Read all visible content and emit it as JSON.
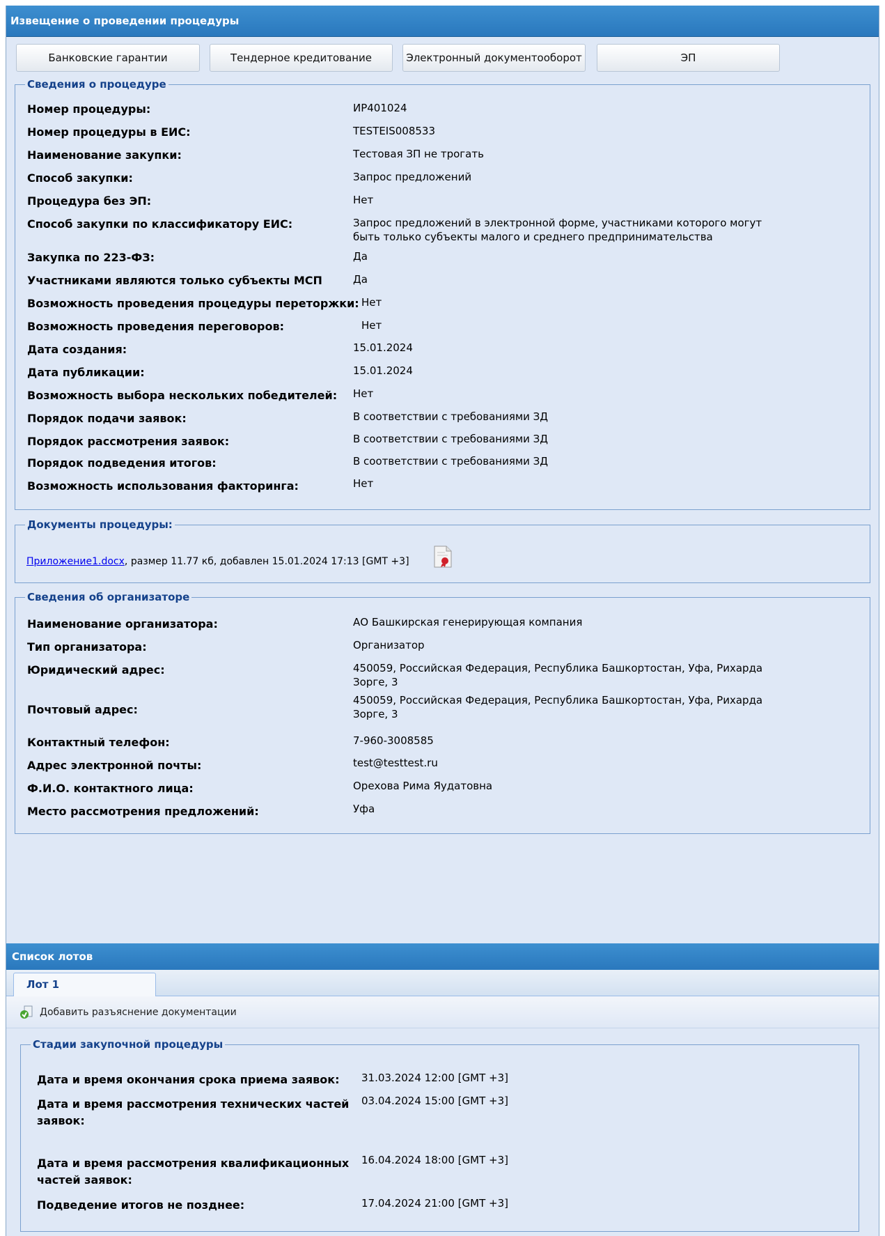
{
  "window": {
    "title": "Извещение о проведении процедуры"
  },
  "top_buttons": [
    {
      "label": "Банковские гарантии"
    },
    {
      "label": "Тендерное кредитование"
    },
    {
      "label": "Электронный документооборот"
    },
    {
      "label": "ЭП"
    }
  ],
  "procedure": {
    "legend": "Сведения о процедуре",
    "rows": [
      {
        "label": "Номер процедуры:",
        "value": "ИР401024"
      },
      {
        "label": "Номер процедуры в ЕИС:",
        "value": "TESTEIS008533"
      },
      {
        "label": "Наименование закупки:",
        "value": "Тестовая ЗП не трогать"
      },
      {
        "label": "Способ закупки:",
        "value": "Запрос предложений"
      },
      {
        "label": "Процедура без ЭП:",
        "value": "Нет"
      },
      {
        "label": "Способ закупки по классификатору ЕИС:",
        "value": "Запрос предложений в электронной форме, участниками которого могут быть только субъекты малого и среднего предпринимательства"
      },
      {
        "label": "Закупка по 223-ФЗ:",
        "value": "Да"
      },
      {
        "label": "Участниками являются только субъекты МСП",
        "value": "Да"
      },
      {
        "label": "Возможность проведения процедуры переторжки:",
        "value": "Нет"
      },
      {
        "label": "Возможность проведения переговоров:",
        "value": "Нет"
      },
      {
        "label": "Дата создания:",
        "value": "15.01.2024"
      },
      {
        "label": "Дата публикации:",
        "value": "15.01.2024"
      },
      {
        "label": "Возможность выбора нескольких победителей:",
        "value": "Нет"
      },
      {
        "label": "Порядок подачи заявок:",
        "value": "В соответствии с требованиями ЗД"
      },
      {
        "label": "Порядок рассмотрения заявок:",
        "value": "В соответствии с требованиями ЗД"
      },
      {
        "label": "Порядок подведения итогов:",
        "value": "В соответствии с требованиями ЗД"
      },
      {
        "label": "Возможность использования факторинга:",
        "value": "Нет"
      }
    ]
  },
  "documents": {
    "legend": "Документы процедуры:",
    "file_name": "Приложение1.docx",
    "file_info": ", размер 11.77 кб, добавлен 15.01.2024 17:13 [GMT +3]",
    "signature_icon": "signature-document-icon"
  },
  "organizer": {
    "legend": "Сведения об организаторе",
    "rows": [
      {
        "label": "Наименование организатора:",
        "value": "АО Башкирская генерирующая компания"
      },
      {
        "label": "Тип организатора:",
        "value": "Организатор"
      },
      {
        "label": "Юридический адрес:",
        "value": "450059, Российская Федерация, Республика Башкортостан, Уфа, Рихарда Зорге, 3"
      },
      {
        "label": "Почтовый адрес:",
        "value": "450059, Российская Федерация, Республика Башкортостан, Уфа, Рихарда Зорге, 3"
      },
      {
        "label": "Контактный телефон:",
        "value": "7-960-3008585"
      },
      {
        "label": "Адрес электронной почты:",
        "value": "test@testtest.ru"
      },
      {
        "label": "Ф.И.О. контактного лица:",
        "value": "Орехова Рима Яудатовна"
      },
      {
        "label": "Место рассмотрения предложений:",
        "value": "Уфа"
      }
    ]
  },
  "lots": {
    "header": "Список лотов",
    "tabs": [
      {
        "label": "Лот 1"
      }
    ],
    "toolbar": {
      "add_clarification_label": "Добавить разъяснение документации",
      "icon": "add-document-icon"
    },
    "stages": {
      "legend": "Стадии закупочной процедуры",
      "rows": [
        {
          "label": "Дата и время окончания срока приема заявок:",
          "value": "31.03.2024 12:00 [GMT +3]"
        },
        {
          "label": "Дата и время рассмотрения технических частей заявок:",
          "value": "03.04.2024 15:00 [GMT +3]"
        },
        {
          "label": "Дата и время рассмотрения квалификационных частей заявок:",
          "value": "16.04.2024 18:00 [GMT +3]"
        },
        {
          "label": "Подведение итогов не позднее:",
          "value": "17.04.2024 21:00 [GMT +3]"
        }
      ]
    }
  },
  "colors": {
    "header_blue": "#2f80c4",
    "panel_bg": "#dfe8f6",
    "legend_text": "#15428b",
    "border": "#7aa0cf"
  }
}
